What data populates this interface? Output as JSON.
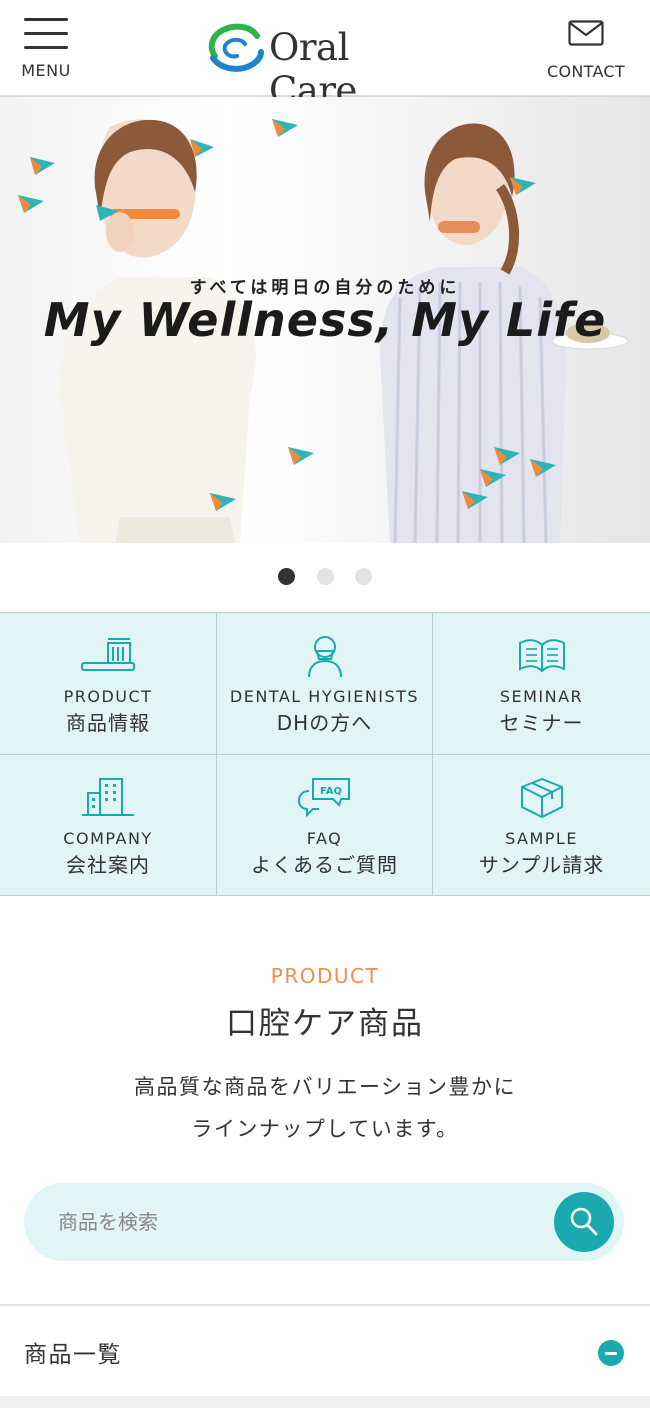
{
  "header": {
    "menu_label": "MENU",
    "logo_text": "Oral Care",
    "contact_label": "CONTACT"
  },
  "hero": {
    "subtitle": "すべては明日の自分のために",
    "title": "My Wellness, My Life",
    "slides_total": 3,
    "active_slide": 1
  },
  "nav": [
    {
      "en": "PRODUCT",
      "ja": "商品情報",
      "icon": "toothbrush-icon"
    },
    {
      "en": "DENTAL HYGIENISTS",
      "ja": "DHの方へ",
      "icon": "hygienist-icon"
    },
    {
      "en": "SEMINAR",
      "ja": "セミナー",
      "icon": "book-icon"
    },
    {
      "en": "COMPANY",
      "ja": "会社案内",
      "icon": "building-icon"
    },
    {
      "en": "FAQ",
      "ja": "よくあるご質問",
      "icon": "faq-bubble-icon"
    },
    {
      "en": "SAMPLE",
      "ja": "サンプル請求",
      "icon": "box-icon"
    }
  ],
  "product_section": {
    "label_en": "PRODUCT",
    "title": "口腔ケア商品",
    "desc_line1": "高品質な商品をバリエーション豊かに",
    "desc_line2": "ラインナップしています。"
  },
  "search": {
    "placeholder": "商品を検索",
    "value": ""
  },
  "accordion": {
    "label": "商品一覧",
    "expanded": true
  },
  "colors": {
    "teal": "#1aa9ad",
    "nav_bg": "#e1f4f6",
    "accent_orange": "#ef8f4f",
    "text": "#333333"
  }
}
